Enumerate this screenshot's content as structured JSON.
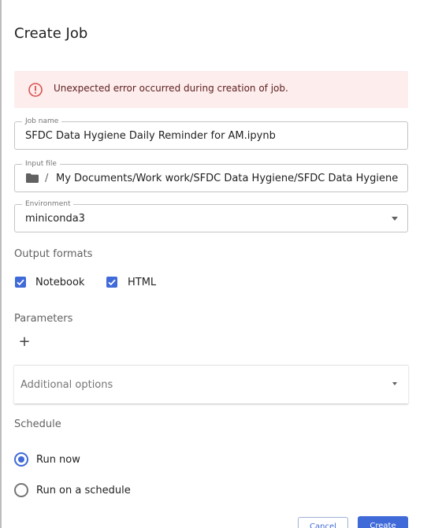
{
  "dialog": {
    "title": "Create Job"
  },
  "alert": {
    "message": "Unexpected error occurred during creation of job.",
    "icon": "error-outline-icon",
    "color": "#d9534f"
  },
  "job_name": {
    "label": "Job name",
    "value": "SFDC Data Hygiene Daily Reminder for AM.ipynb"
  },
  "input_file": {
    "label": "Input file",
    "separator": "/",
    "value": "My Documents/Work work/SFDC Data Hygiene/SFDC Data Hygiene Daily Reminder for AM.ipynb",
    "icon": "folder-icon"
  },
  "environment": {
    "label": "Environment",
    "value": "miniconda3"
  },
  "output_formats": {
    "label": "Output formats",
    "options": [
      {
        "label": "Notebook",
        "checked": true
      },
      {
        "label": "HTML",
        "checked": true
      }
    ]
  },
  "parameters": {
    "label": "Parameters",
    "add_symbol": "+"
  },
  "additional_options": {
    "label": "Additional options"
  },
  "schedule": {
    "label": "Schedule",
    "options": [
      {
        "label": "Run now",
        "selected": true
      },
      {
        "label": "Run on a schedule",
        "selected": false
      }
    ]
  },
  "actions": {
    "cancel_label": "Cancel",
    "create_label": "Create"
  },
  "colors": {
    "accent": "#3f6ad8",
    "alert_bg": "#fdeded"
  }
}
